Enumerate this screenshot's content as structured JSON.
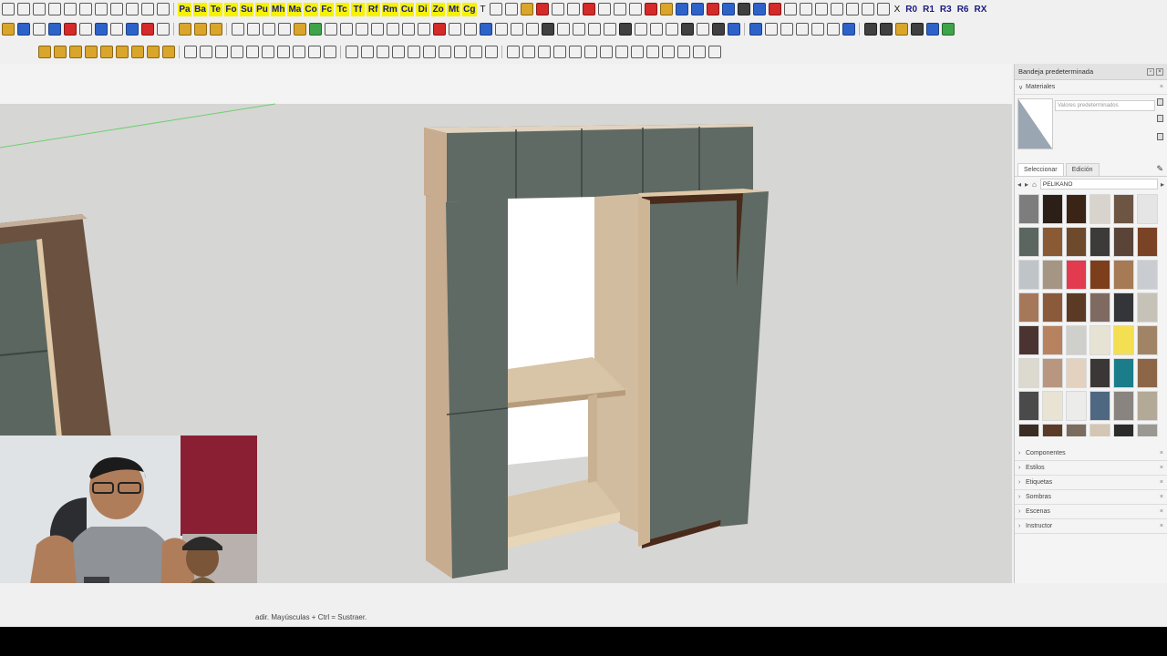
{
  "toolbar1": {
    "tags": [
      "Pa",
      "Ba",
      "Te",
      "Fo",
      "Su",
      "Pu",
      "Mh",
      "Ma",
      "Co",
      "Fc",
      "Tc",
      "Tf",
      "Rf",
      "Rm",
      "Cu",
      "Di",
      "Zo",
      "Mt",
      "Cg"
    ],
    "right_labels": [
      "R0",
      "R1",
      "R3",
      "R6",
      "RX"
    ]
  },
  "viewport": {
    "wall_color": "#d6d6d4",
    "cabinet_door_color": "#5f6a64",
    "wood_color": "#d2bca0",
    "frame_color": "#4a2a1a"
  },
  "status": {
    "hint_text": "adir. Mayúsculas + Ctrl = Sustraer."
  },
  "tray": {
    "title": "Bandeja predeterminada",
    "materials_label": "Materiales",
    "material_name_placeholder": "Valores predeterminados",
    "tab_select": "Seleccionar",
    "tab_edit": "Edición",
    "library": "PELIKANO",
    "swatches": [
      "#7d7d7d",
      "#2b1f17",
      "#3a2416",
      "#d8d3cc",
      "#6d5544",
      "#e5e5e5",
      "#5b6660",
      "#8a5a34",
      "#6e4a2c",
      "#3c3b3a",
      "#5a4438",
      "#7a4326",
      "#bfc4c9",
      "#a59683",
      "#e23a4e",
      "#7d3f1b",
      "#a57a55",
      "#c9cdd2",
      "#a6785a",
      "#8b5a3a",
      "#5a3a25",
      "#7f6a62",
      "#333538",
      "#c7c2b8",
      "#4a3330",
      "#b7825f",
      "#cfcfcc",
      "#e7e3d4",
      "#f4de52",
      "#a18466",
      "#dcd9cf",
      "#b89680",
      "#e3d2c0",
      "#3b3736",
      "#1b7c8a",
      "#8d6648",
      "#4a4a4a",
      "#e8e3d3",
      "#ececea",
      "#4f6882",
      "#8a8480",
      "#b3a997",
      "#3a2c23",
      "#5c3a28",
      "#7a6c5e",
      "#d3c6b2",
      "#2b2b2b",
      "#9b9893"
    ],
    "sections": [
      "Componentes",
      "Estilos",
      "Etiquetas",
      "Sombras",
      "Escenas",
      "Instructor"
    ]
  }
}
